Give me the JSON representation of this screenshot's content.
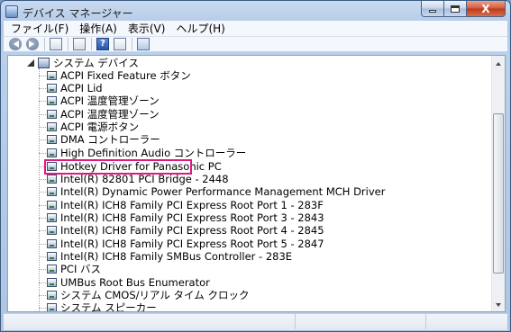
{
  "window": {
    "title": "デバイス マネージャー",
    "caption_close_label": "X"
  },
  "menu": [
    "ファイル(F)",
    "操作(A)",
    "表示(V)",
    "ヘルプ(H)"
  ],
  "toolbar": {
    "icons": [
      "back-arrow",
      "forward-arrow",
      "properties",
      "scan",
      "help",
      "view",
      "update-driver"
    ],
    "help_label": "?"
  },
  "tree": {
    "root_label": "システム デバイス",
    "items": [
      "ACPI Fixed Feature ボタン",
      "ACPI Lid",
      "ACPI 温度管理ゾーン",
      "ACPI 温度管理ゾーン",
      "ACPI 電源ボタン",
      "DMA コントローラー",
      "High Definition Audio コントローラー",
      "Hotkey Driver for Panasonic PC",
      "Intel(R) 82801 PCI Bridge - 2448",
      "Intel(R) Dynamic Power Performance Management MCH Driver",
      "Intel(R) ICH8 Family PCI Express Root Port 1 - 283F",
      "Intel(R) ICH8 Family PCI Express Root Port 3 - 2843",
      "Intel(R) ICH8 Family PCI Express Root Port 4 - 2845",
      "Intel(R) ICH8 Family PCI Express Root Port 5 - 2847",
      "Intel(R) ICH8 Family SMBus Controller - 283E",
      "PCI バス",
      "UMBus Root Bus Enumerator",
      "システム CMOS/リアル タイム クロック",
      "システム スピーカー"
    ],
    "highlighted_item": "Hotkey Driver for Panasonic PC"
  },
  "colors": {
    "highlight_border": "#e0187f",
    "titlebar": "#b2c9e6"
  }
}
